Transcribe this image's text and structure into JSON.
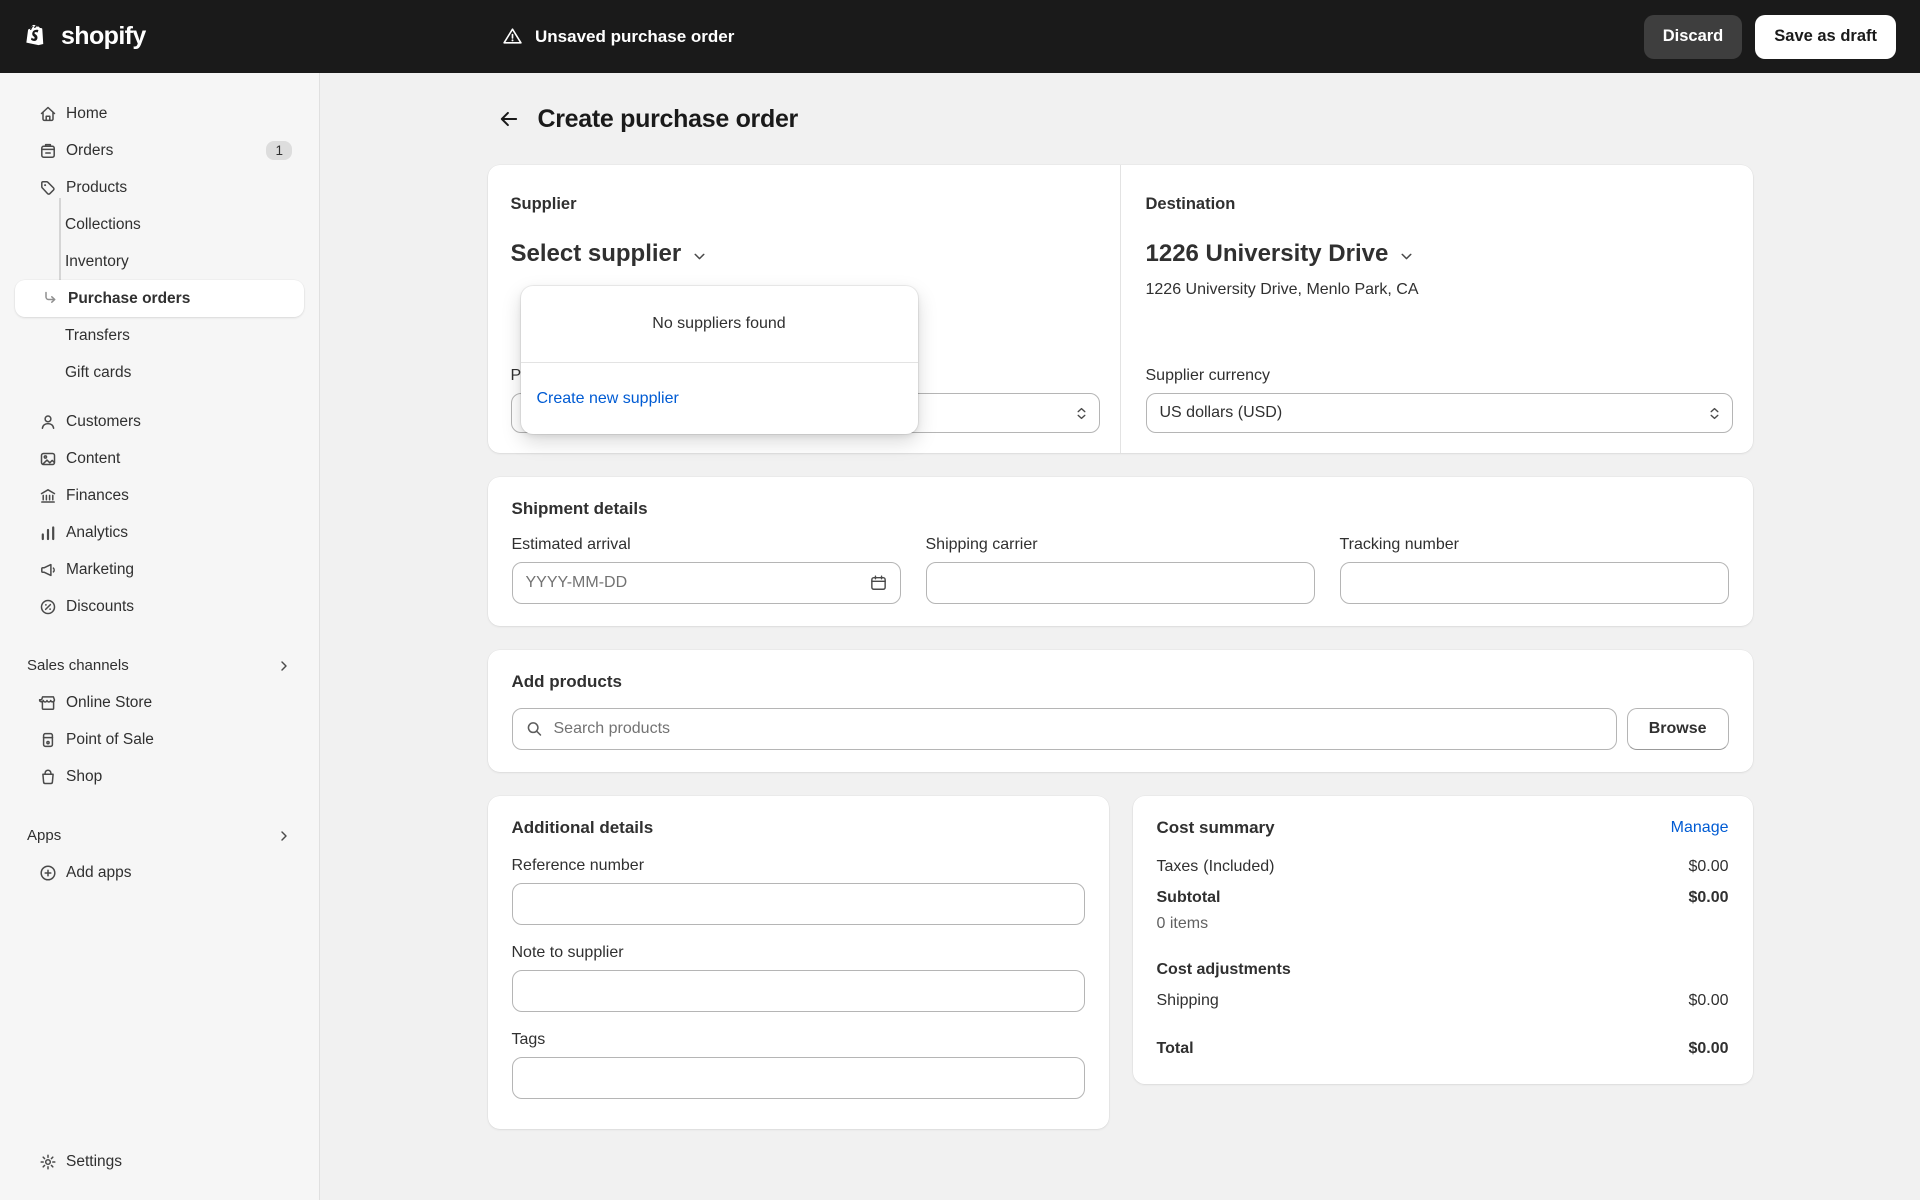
{
  "topbar": {
    "logo_text": "shopify",
    "status_text": "Unsaved purchase order",
    "discard_button": "Discard",
    "save_button": "Save as draft"
  },
  "sidebar": {
    "primary": [
      {
        "label": "Home"
      },
      {
        "label": "Orders",
        "badge": "1"
      },
      {
        "label": "Products"
      }
    ],
    "products_children": [
      {
        "label": "Collections"
      },
      {
        "label": "Inventory"
      },
      {
        "label": "Purchase orders"
      },
      {
        "label": "Transfers"
      },
      {
        "label": "Gift cards"
      }
    ],
    "secondary": [
      {
        "label": "Customers"
      },
      {
        "label": "Content"
      },
      {
        "label": "Finances"
      },
      {
        "label": "Analytics"
      },
      {
        "label": "Marketing"
      },
      {
        "label": "Discounts"
      }
    ],
    "sales_channels": {
      "header": "Sales channels",
      "items": [
        {
          "label": "Online Store"
        },
        {
          "label": "Point of Sale"
        },
        {
          "label": "Shop"
        }
      ]
    },
    "apps": {
      "header": "Apps",
      "items": [
        {
          "label": "Add apps"
        }
      ]
    },
    "settings_label": "Settings"
  },
  "page": {
    "title": "Create purchase order"
  },
  "supplier_card": {
    "supplier": {
      "label": "Supplier",
      "value": "Select supplier",
      "hidden_field_fragment": "P",
      "popover": {
        "empty_text": "No suppliers found",
        "create_link": "Create new supplier"
      }
    },
    "destination": {
      "label": "Destination",
      "value": "1226 University Drive",
      "address": "1226 University Drive, Menlo Park, CA"
    },
    "currency": {
      "label": "Supplier currency",
      "value": "US dollars (USD)"
    }
  },
  "shipment_card": {
    "title": "Shipment details",
    "estimated_arrival": {
      "label": "Estimated arrival",
      "placeholder": "YYYY-MM-DD"
    },
    "shipping_carrier": {
      "label": "Shipping carrier"
    },
    "tracking_number": {
      "label": "Tracking number"
    }
  },
  "products_card": {
    "title": "Add products",
    "search_placeholder": "Search products",
    "browse_button": "Browse"
  },
  "details_card": {
    "title": "Additional details",
    "reference_label": "Reference number",
    "note_label": "Note to supplier",
    "tags_label": "Tags"
  },
  "cost_card": {
    "title": "Cost summary",
    "manage_link": "Manage",
    "taxes_label": "Taxes",
    "taxes_note": "(Included)",
    "taxes_value": "$0.00",
    "subtotal_label": "Subtotal",
    "subtotal_value": "$0.00",
    "items_text": "0 items",
    "adjustments_label": "Cost adjustments",
    "shipping_label": "Shipping",
    "shipping_value": "$0.00",
    "total_label": "Total",
    "total_value": "$0.00"
  }
}
